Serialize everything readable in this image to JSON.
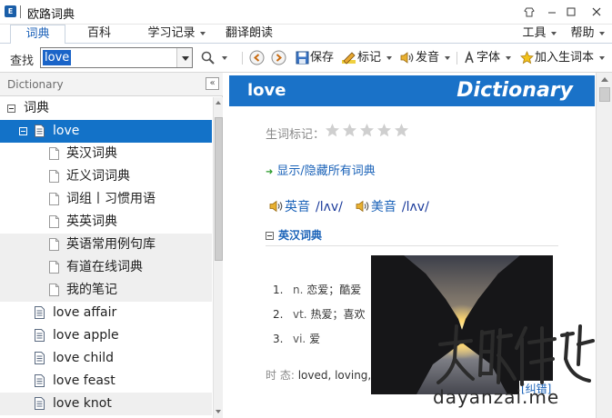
{
  "window": {
    "title": "欧路词典",
    "logo_text": "E"
  },
  "menu": {
    "tabs": [
      "词典",
      "百科",
      "学习记录",
      "翻译朗读"
    ],
    "right": [
      "工具",
      "帮助"
    ]
  },
  "toolbar": {
    "find_label": "查找",
    "search_value": "love",
    "save_label": "保存",
    "mark_label": "标记",
    "pronounce_label": "发音",
    "font_label": "字体",
    "add_vocab_label": "加入生词本"
  },
  "left_panel": {
    "header": "Dictionary",
    "collapse_glyph": "«",
    "tree": [
      {
        "label": "词典",
        "kind": "root"
      },
      {
        "label": "love",
        "kind": "word-expanded",
        "selected": true
      },
      {
        "label": "英汉词典",
        "kind": "sub"
      },
      {
        "label": "近义词词典",
        "kind": "sub"
      },
      {
        "label": "词组丨习惯用语",
        "kind": "sub"
      },
      {
        "label": "英英词典",
        "kind": "sub"
      },
      {
        "label": "英语常用例句库",
        "kind": "sub"
      },
      {
        "label": "有道在线词典",
        "kind": "sub"
      },
      {
        "label": "我的笔记",
        "kind": "sub"
      },
      {
        "label": "love affair",
        "kind": "word"
      },
      {
        "label": "love apple",
        "kind": "word"
      },
      {
        "label": "love child",
        "kind": "word"
      },
      {
        "label": "love feast",
        "kind": "word"
      },
      {
        "label": "love knot",
        "kind": "word"
      }
    ]
  },
  "entry": {
    "headword": "love",
    "banner": "Dictionary",
    "star_label": "生词标记：",
    "stars_filled": 0,
    "stars_total": 5,
    "toggle_link": "显示/隐藏所有词典",
    "pron_uk_label": "英音",
    "pron_uk": "/lʌv/",
    "pron_us_label": "美音",
    "pron_us": "/lʌv/",
    "section_title": "英汉词典",
    "definitions": [
      {
        "num": "1.",
        "pos": "n.",
        "text": "恋爱；酷爱"
      },
      {
        "num": "2.",
        "pos": "vt.",
        "text": "热爱；喜欢"
      },
      {
        "num": "3.",
        "pos": "vi.",
        "text": "爱"
      }
    ],
    "tense_label": "时 态:",
    "tense_value": "loved, loving,",
    "correction_link": "[纠错]"
  },
  "watermark": {
    "domain": "dayanzai.me"
  },
  "colors": {
    "accent": "#1a72c8",
    "selection": "#1372c8",
    "link": "#1a62b8"
  }
}
